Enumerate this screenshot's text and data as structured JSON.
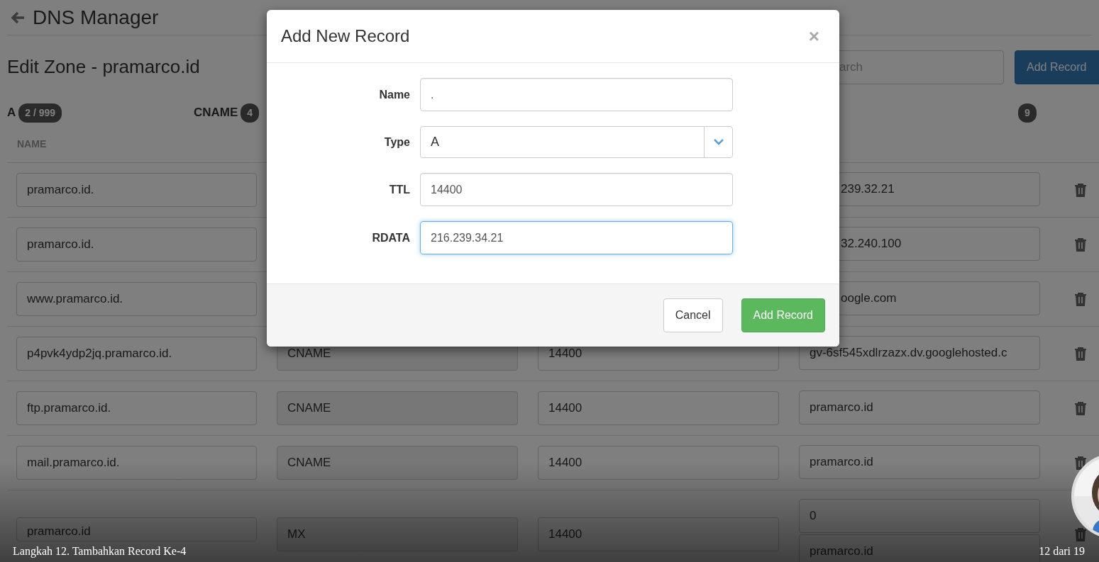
{
  "page": {
    "title": "DNS Manager",
    "zone_title": "Edit Zone - pramarco.id",
    "search": {
      "placeholder": "arch"
    },
    "add_button": "Add Record",
    "type_tabs": [
      {
        "label": "A",
        "count": "2 / 999"
      },
      {
        "label": "CNAME",
        "count": "4"
      },
      {
        "count": "9"
      }
    ],
    "columns": [
      "NAME"
    ],
    "records": [
      {
        "name": "pramarco.id.",
        "rdata": [
          "239.32.21"
        ],
        "rdata_clipped": true
      },
      {
        "name": "pramarco.id.",
        "rdata": [
          "32.240.100"
        ],
        "rdata_clipped": true
      },
      {
        "name": "www.pramarco.id.",
        "rdata": [
          "oogle.com"
        ],
        "rdata_clipped": true
      },
      {
        "name": "p4pvk4ydp2jq.pramarco.id.",
        "type": "CNAME",
        "ttl": "14400",
        "rdata": [
          "gv-6sf545xdlrzazx.dv.googlehosted.c"
        ],
        "rdata_clipped": false
      },
      {
        "name": "ftp.pramarco.id.",
        "type": "CNAME",
        "ttl": "14400",
        "rdata": [
          "pramarco.id"
        ],
        "rdata_clipped": false
      },
      {
        "name": "mail.pramarco.id.",
        "type": "CNAME",
        "ttl": "14400",
        "rdata": [
          "pramarco.id"
        ],
        "rdata_clipped": false
      },
      {
        "name": "pramarco.id",
        "type": "MX",
        "ttl": "14400",
        "rdata": [
          "0",
          "pramarco.id"
        ],
        "rdata_clipped": false
      }
    ]
  },
  "modal": {
    "title": "Add New Record",
    "close": "×",
    "fields": [
      {
        "kind": "text",
        "label": "Name",
        "value": ".",
        "focused": false
      },
      {
        "kind": "select",
        "label": "Type",
        "value": "A",
        "focused": false
      },
      {
        "kind": "text",
        "label": "TTL",
        "value": "14400",
        "focused": false
      },
      {
        "kind": "text",
        "label": "RDATA",
        "value": "216.239.34.21",
        "focused": true
      }
    ],
    "buttons": [
      {
        "label": "Cancel",
        "kind": "default"
      },
      {
        "label": "Add Record",
        "kind": "success"
      }
    ]
  },
  "caption": {
    "step": "Langkah 12. Tambahkan Record Ke-4",
    "progress": "12 dari 19"
  }
}
